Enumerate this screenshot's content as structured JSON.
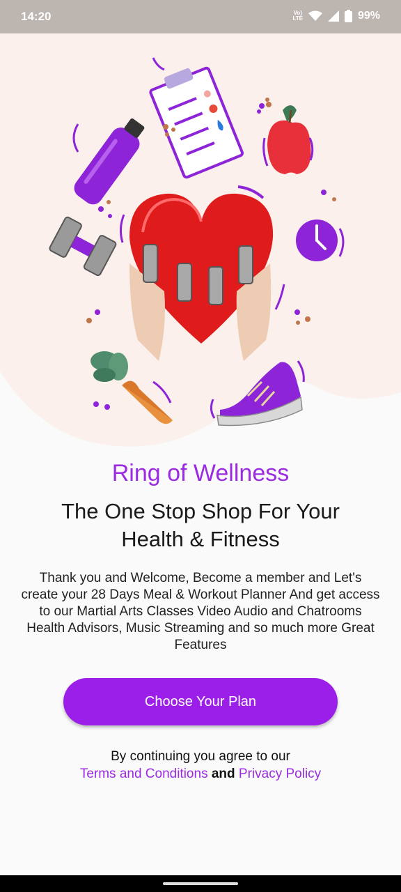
{
  "status": {
    "time": "14:20",
    "battery": "99%",
    "network_label": "VoLTE"
  },
  "app": {
    "brand": "Ring of Wellness",
    "headline": "The One Stop Shop For Your Health & Fitness",
    "description": "Thank you and Welcome, Become a member and Let's create your 28 Days Meal & Workout Planner And get access to our Martial Arts Classes Video Audio and Chatrooms Health Advisors, Music Streaming and so much more Great Features",
    "cta_label": "Choose Your Plan",
    "legal_prefix": "By continuing you agree to our",
    "terms_label": "Terms and Conditions",
    "and_label": "and",
    "privacy_label": "Privacy Policy"
  },
  "colors": {
    "accent": "#9b1fe8",
    "hero_bg": "#fbf0ec",
    "heart": "#e01b1b"
  },
  "icons": [
    "wifi-icon",
    "signal-icon",
    "battery-icon",
    "water-bottle-icon",
    "clipboard-icon",
    "apple-icon",
    "dumbbell-icon",
    "heart-icon",
    "clock-icon",
    "carrot-icon",
    "sneaker-icon"
  ]
}
